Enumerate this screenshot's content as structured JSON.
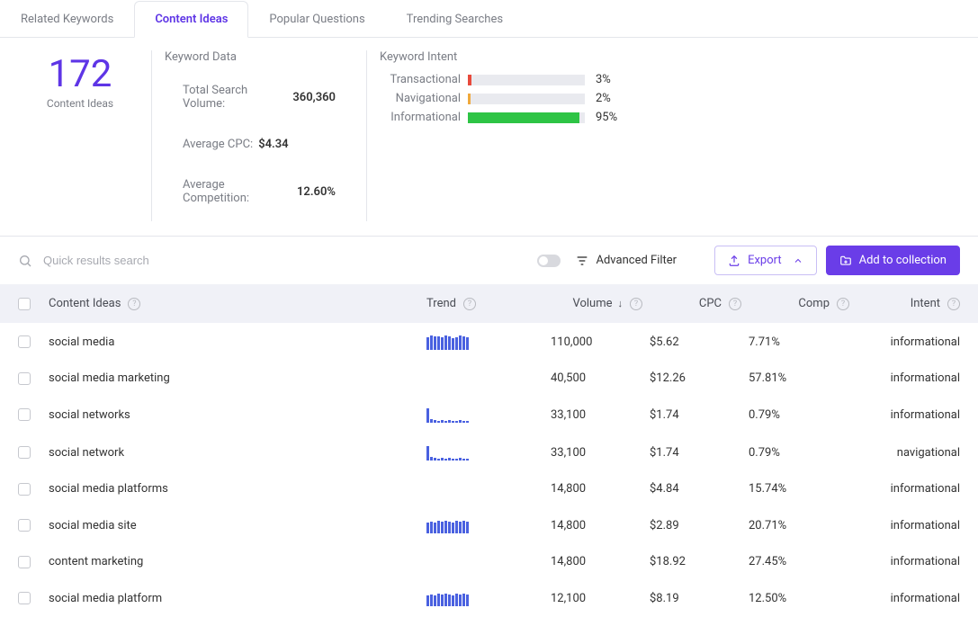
{
  "tabs": [
    {
      "label": "Related Keywords",
      "active": false
    },
    {
      "label": "Content Ideas",
      "active": true
    },
    {
      "label": "Popular Questions",
      "active": false
    },
    {
      "label": "Trending Searches",
      "active": false
    }
  ],
  "summary": {
    "count": "172",
    "count_label": "Content Ideas",
    "keyword_data_title": "Keyword Data",
    "total_search_volume_label": "Total Search Volume:",
    "total_search_volume": "360,360",
    "avg_cpc_label": "Average CPC:",
    "avg_cpc": "$4.34",
    "avg_competition_label": "Average Competition:",
    "avg_competition": "12.60%",
    "intent_title": "Keyword Intent",
    "intent": [
      {
        "label": "Transactional",
        "pct": "3%",
        "width": 3,
        "color": "#e84a3c"
      },
      {
        "label": "Navigational",
        "pct": "2%",
        "width": 2,
        "color": "#f0a93c"
      },
      {
        "label": "Informational",
        "pct": "95%",
        "width": 95,
        "color": "#2ec445"
      }
    ]
  },
  "toolbar": {
    "search_placeholder": "Quick results search",
    "advanced_filter_label": "Advanced Filter",
    "export_label": "Export",
    "add_label": "Add to collection"
  },
  "headers": {
    "content_ideas": "Content Ideas",
    "trend": "Trend",
    "volume": "Volume",
    "cpc": "CPC",
    "comp": "Comp",
    "intent": "Intent"
  },
  "rows": [
    {
      "idea": "social media",
      "trend": [
        14,
        16,
        15,
        15,
        14,
        16,
        15,
        13,
        14,
        16,
        15,
        14
      ],
      "volume": "110,000",
      "cpc": "$5.62",
      "comp": "7.71%",
      "intent": "informational"
    },
    {
      "idea": "social media marketing",
      "trend": [],
      "volume": "40,500",
      "cpc": "$12.26",
      "comp": "57.81%",
      "intent": "informational"
    },
    {
      "idea": "social networks",
      "trend": [
        16,
        4,
        3,
        2,
        3,
        2,
        3,
        2,
        2,
        3,
        2,
        2
      ],
      "volume": "33,100",
      "cpc": "$1.74",
      "comp": "0.79%",
      "intent": "informational"
    },
    {
      "idea": "social network",
      "trend": [
        16,
        4,
        3,
        2,
        3,
        2,
        3,
        2,
        2,
        3,
        2,
        2
      ],
      "volume": "33,100",
      "cpc": "$1.74",
      "comp": "0.79%",
      "intent": "navigational"
    },
    {
      "idea": "social media platforms",
      "trend": [],
      "volume": "14,800",
      "cpc": "$4.84",
      "comp": "15.74%",
      "intent": "informational"
    },
    {
      "idea": "social media site",
      "trend": [
        12,
        13,
        12,
        14,
        13,
        14,
        13,
        12,
        14,
        13,
        14,
        13
      ],
      "volume": "14,800",
      "cpc": "$2.89",
      "comp": "20.71%",
      "intent": "informational"
    },
    {
      "idea": "content marketing",
      "trend": [],
      "volume": "14,800",
      "cpc": "$18.92",
      "comp": "27.45%",
      "intent": "informational"
    },
    {
      "idea": "social media platform",
      "trend": [
        12,
        13,
        12,
        14,
        13,
        14,
        13,
        12,
        14,
        13,
        14,
        13
      ],
      "volume": "12,100",
      "cpc": "$8.19",
      "comp": "12.50%",
      "intent": "informational"
    }
  ]
}
